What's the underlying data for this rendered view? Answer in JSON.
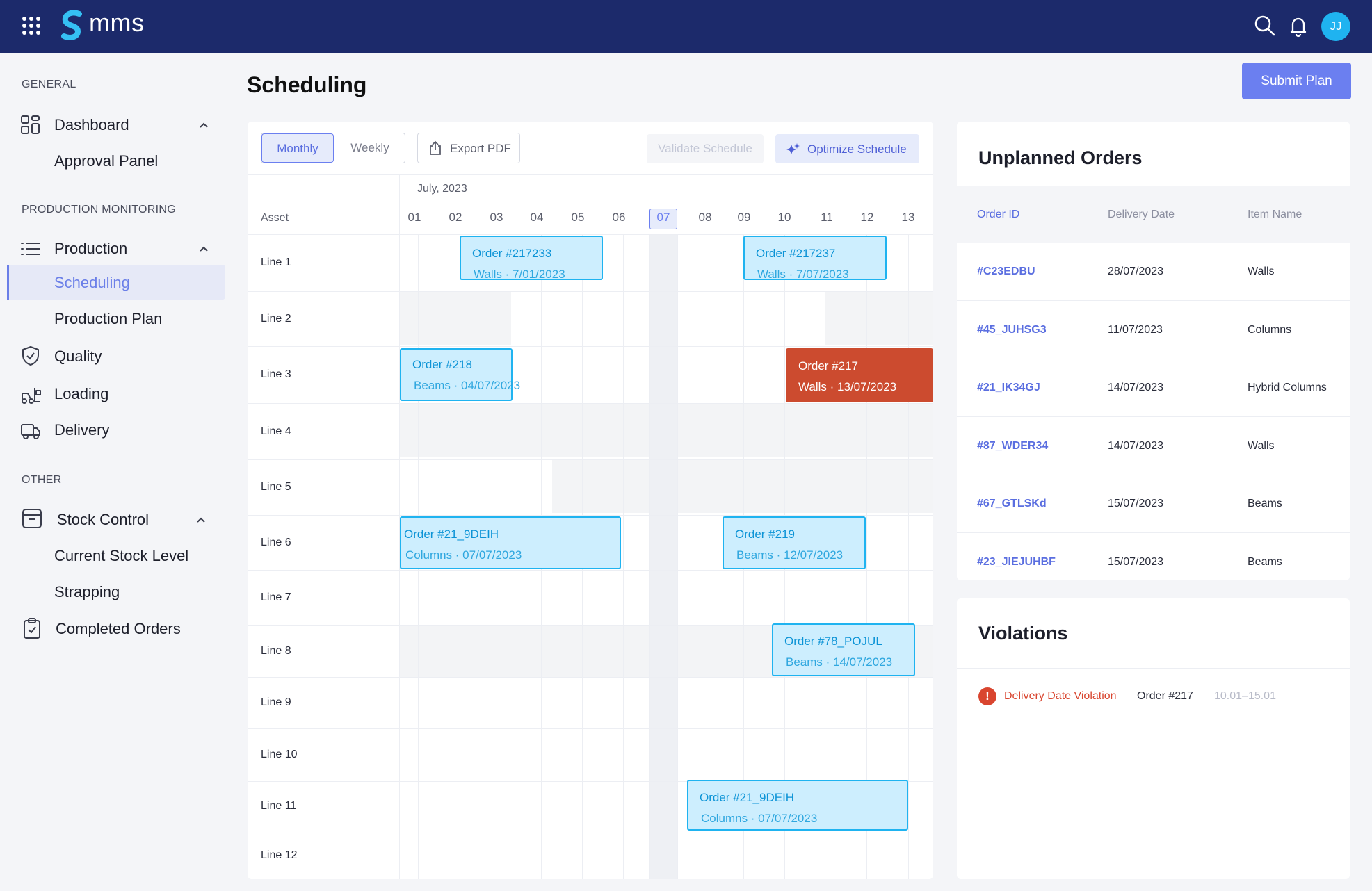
{
  "app": {
    "name": "mms",
    "avatar_initials": "JJ"
  },
  "topbar_icons": [
    "apps-grid-icon",
    "search-icon",
    "bell-icon"
  ],
  "sidebar": {
    "sections": [
      "GENERAL",
      "PRODUCTION MONITORING",
      "OTHER"
    ],
    "items": [
      {
        "label": "Dashboard",
        "icon": "dashboard-icon"
      },
      {
        "label": "Approval Panel"
      },
      {
        "label": "Production",
        "icon": "list-icon"
      },
      {
        "label": "Scheduling",
        "active": true
      },
      {
        "label": "Production Plan"
      },
      {
        "label": "Quality",
        "icon": "shield-check-icon"
      },
      {
        "label": "Loading",
        "icon": "forklift-icon"
      },
      {
        "label": "Delivery",
        "icon": "truck-icon"
      },
      {
        "label": "Stock Control",
        "icon": "archive-box-icon"
      },
      {
        "label": "Current Stock Level"
      },
      {
        "label": "Strapping"
      },
      {
        "label": "Completed Orders",
        "icon": "clipboard-check-icon"
      }
    ]
  },
  "page": {
    "title": "Scheduling",
    "submit_label": "Submit Plan"
  },
  "toolbar": {
    "tabs": [
      "Monthly",
      "Weekly"
    ],
    "active_tab": "Monthly",
    "export_label": "Export PDF",
    "validate_label": "Validate Schedule",
    "optimize_label": "Optimize Schedule"
  },
  "schedule": {
    "month": "July, 2023",
    "asset_header": "Asset",
    "days": [
      "01",
      "02",
      "03",
      "04",
      "05",
      "06",
      "07",
      "08",
      "09",
      "10",
      "11",
      "12",
      "13"
    ],
    "today": "07",
    "lines": [
      "Line 1",
      "Line 2",
      "Line 3",
      "Line 4",
      "Line 5",
      "Line 6",
      "Line 7",
      "Line 8",
      "Line 9",
      "Line 10",
      "Line 11",
      "Line 12"
    ],
    "orders": [
      {
        "title": "Order #217233",
        "sub": "Walls · 7/01/2023",
        "status": "planned"
      },
      {
        "title": "Order #217237",
        "sub": "Walls · 7/07/2023",
        "status": "planned"
      },
      {
        "title": "Order #218",
        "sub": "Beams · 04/07/2023",
        "status": "planned"
      },
      {
        "title": "Order #217",
        "sub": "Walls · 13/07/2023",
        "status": "violation"
      },
      {
        "title": "Order #21_9DEIH",
        "sub": "Columns · 07/07/2023",
        "status": "planned"
      },
      {
        "title": "Order #219",
        "sub": "Beams · 12/07/2023",
        "status": "planned"
      },
      {
        "title": "Order #78_POJUL",
        "sub": "Beams · 14/07/2023",
        "status": "planned"
      },
      {
        "title": "Order #21_9DEIH",
        "sub": "Columns · 07/07/2023",
        "status": "planned"
      }
    ]
  },
  "unplanned": {
    "title": "Unplanned Orders",
    "headers": [
      "Order ID",
      "Delivery Date",
      "Item Name"
    ],
    "rows": [
      [
        "#C23EDBU",
        "28/07/2023",
        "Walls"
      ],
      [
        "#45_JUHSG3",
        "11/07/2023",
        "Columns"
      ],
      [
        "#21_IK34GJ",
        "14/07/2023",
        "Hybrid Columns"
      ],
      [
        "#87_WDER34",
        "14/07/2023",
        "Walls"
      ],
      [
        "#67_GTLSKd",
        "15/07/2023",
        "Beams"
      ],
      [
        "#23_JIEJUHBF",
        "15/07/2023",
        "Beams"
      ]
    ]
  },
  "violations": {
    "title": "Violations",
    "items": [
      {
        "type": "Delivery Date Violation",
        "order": "Order #217",
        "range": "10.01–15.01"
      }
    ]
  },
  "colors": {
    "topbar": "#1c2a6b",
    "accent": "#6b7ff0",
    "order_fill": "#cdeefe",
    "order_border": "#1fb3f0",
    "violation": "#cc4b2f"
  }
}
